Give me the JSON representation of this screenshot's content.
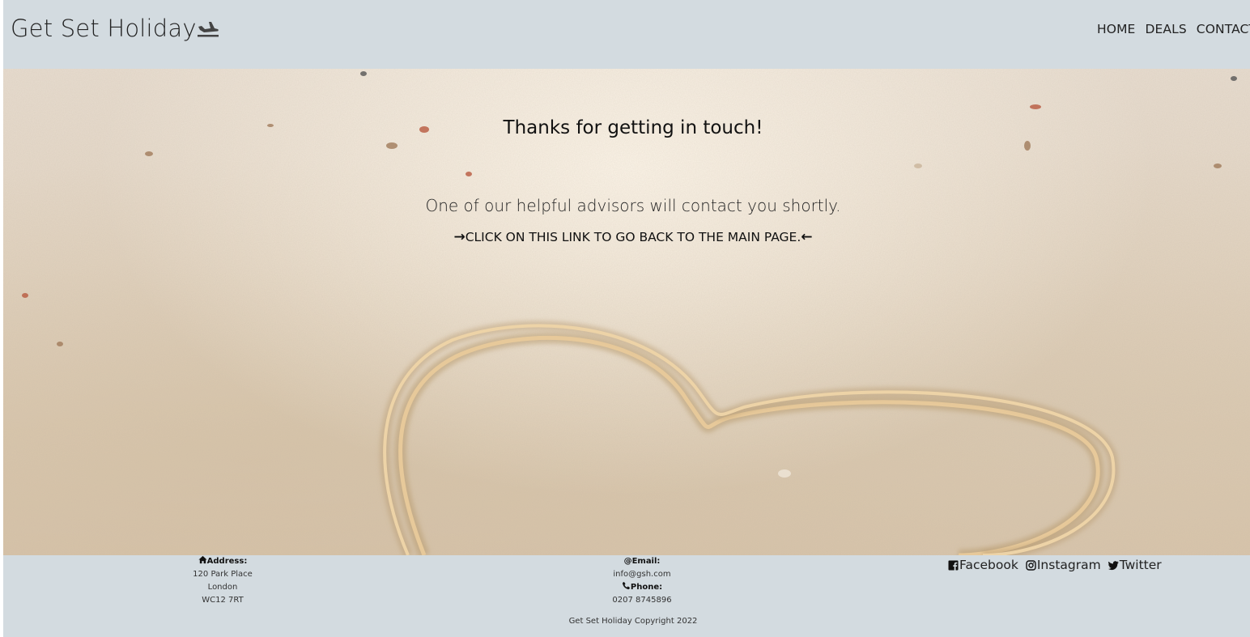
{
  "header": {
    "logo_text": "Get Set Holiday",
    "logo_icon": "plane-landing-icon",
    "nav": [
      {
        "label": "HOME"
      },
      {
        "label": "DEALS"
      },
      {
        "label": "CONTACT"
      }
    ]
  },
  "hero": {
    "background": "heart-drawn-in-sand-photo",
    "title": "Thanks for getting in touch!",
    "message": "One of our helpful advisors will contact you shortly.",
    "link_text": "CLICK ON THIS LINK TO GO BACK TO THE MAIN PAGE.",
    "link_arrow_left": "→",
    "link_arrow_right": "←"
  },
  "footer": {
    "address": {
      "icon": "home-icon",
      "label": "Address:",
      "lines": [
        "120 Park Place",
        "London",
        "WC12 7RT"
      ]
    },
    "email": {
      "icon": "at-icon",
      "label": "@Email:",
      "value": "info@gsh.com"
    },
    "phone": {
      "icon": "phone-icon",
      "label": "Phone:",
      "value": "0207 8745896"
    },
    "social": [
      {
        "label": "Facebook",
        "icon": "facebook-icon"
      },
      {
        "label": "Instagram",
        "icon": "instagram-icon"
      },
      {
        "label": "Twitter",
        "icon": "twitter-icon"
      }
    ],
    "copyright": "Get Set Holiday Copyright 2022"
  },
  "colors": {
    "header_bg": "#d3dbe0",
    "footer_bg": "#d3dbe0",
    "text": "#222222"
  }
}
